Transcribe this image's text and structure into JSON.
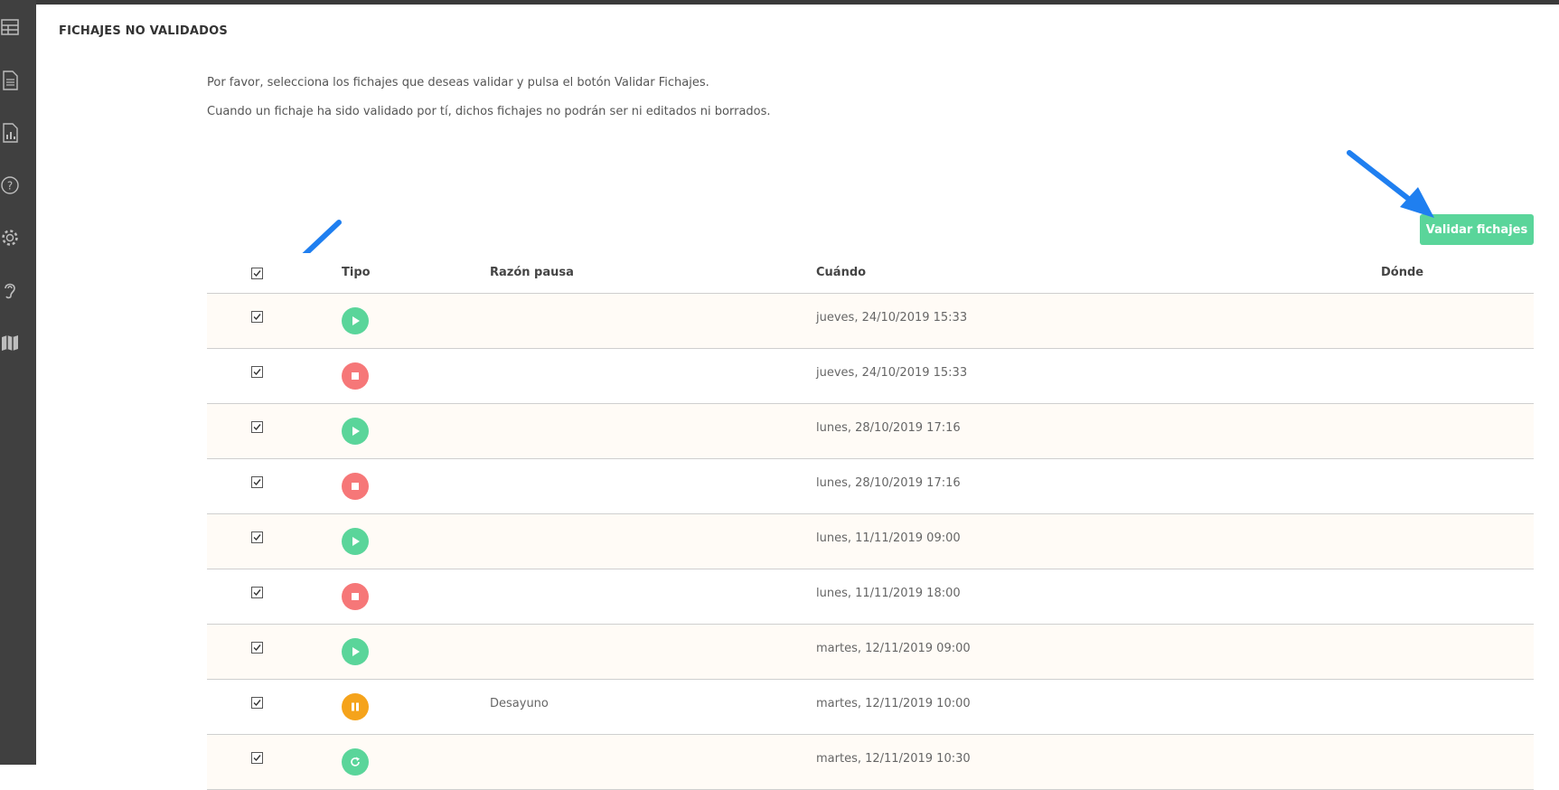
{
  "page": {
    "title": "FICHAJES NO VALIDADOS",
    "intro_line_1": "Por favor, selecciona los fichajes que deseas validar y pulsa el botón Validar Fichajes.",
    "intro_line_2": "Cuando un fichaje ha sido validado por tí, dichos fichajes no podrán ser ni editados ni borrados."
  },
  "sidebar": {
    "icons": [
      "dashboard-icon",
      "document-icon",
      "report-icon",
      "help-icon",
      "gear-icon",
      "hearing-icon",
      "map-icon"
    ]
  },
  "actions": {
    "validate_label": "Validar fichajes"
  },
  "colors": {
    "accent_green": "#5ad59a",
    "start_green": "#5ad59a",
    "stop_red": "#f67778",
    "pause_orange": "#f5a31b",
    "arrow_blue": "#1f7ff0"
  },
  "table": {
    "columns": {
      "tipo": "Tipo",
      "razon": "Razón pausa",
      "cuando": "Cuándo",
      "donde": "Dónde"
    },
    "rows": [
      {
        "type": "start",
        "reason": "",
        "when": "jueves, 24/10/2019 15:33",
        "where": ""
      },
      {
        "type": "stop",
        "reason": "",
        "when": "jueves, 24/10/2019 15:33",
        "where": ""
      },
      {
        "type": "start",
        "reason": "",
        "when": "lunes, 28/10/2019 17:16",
        "where": ""
      },
      {
        "type": "stop",
        "reason": "",
        "when": "lunes, 28/10/2019 17:16",
        "where": ""
      },
      {
        "type": "start",
        "reason": "",
        "when": "lunes, 11/11/2019 09:00",
        "where": ""
      },
      {
        "type": "stop",
        "reason": "",
        "when": "lunes, 11/11/2019 18:00",
        "where": ""
      },
      {
        "type": "start",
        "reason": "",
        "when": "martes, 12/11/2019 09:00",
        "where": ""
      },
      {
        "type": "pause",
        "reason": "Desayuno",
        "when": "martes, 12/11/2019 10:00",
        "where": ""
      },
      {
        "type": "resume",
        "reason": "",
        "when": "martes, 12/11/2019 10:30",
        "where": ""
      }
    ]
  }
}
